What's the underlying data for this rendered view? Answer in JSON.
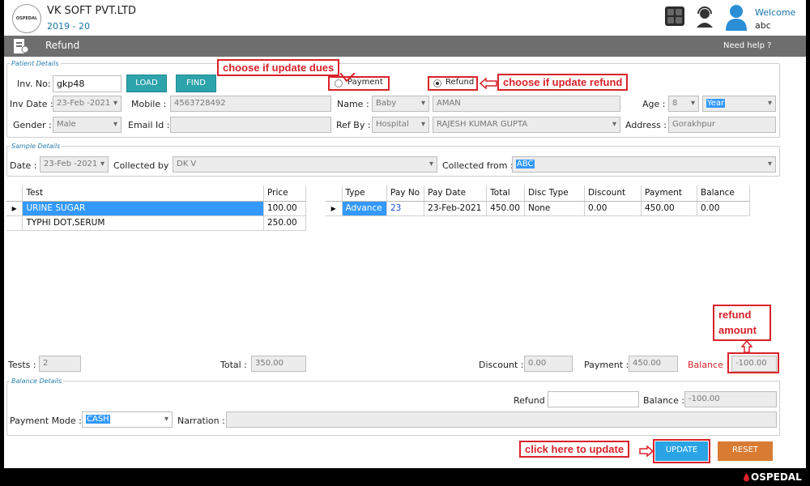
{
  "app": {
    "company": "VK SOFT PVT.LTD",
    "year": "2019 - 20",
    "logo_text": "OSPEDAL",
    "welcome": "Welcome",
    "user": "abc",
    "brand": "OSPEDAL"
  },
  "titlebar": {
    "title": "Refund",
    "help": "Need help ?"
  },
  "patient": {
    "legend": "Patient Details",
    "inv_label": "Inv. No:",
    "inv_value": "gkp48",
    "load_label": "LOAD",
    "find_label": "FIND",
    "payment_radio": "Payment",
    "refund_radio": "Refund",
    "inv_date_label": "Inv Date :",
    "inv_date": "23-Feb -2021",
    "mobile_label": "Mobile :",
    "mobile": "4563728492",
    "name_label": "Name :",
    "name_prefix": "Baby",
    "name": "AMAN",
    "age_label": "Age :",
    "age": "8",
    "age_unit": "Year",
    "gender_label": "Gender :",
    "gender": "Male",
    "email_label": "Email Id :",
    "email": "",
    "refby_label": "Ref By :",
    "refby_type": "Hospital",
    "refby_name": "RAJESH KUMAR GUPTA",
    "address_label": "Address :",
    "address": "Gorakhpur"
  },
  "sample": {
    "legend": "Sample Details",
    "date_label": "Date :",
    "date": "23-Feb -2021",
    "collected_by_label": "Collected by :",
    "collected_by": "DK V",
    "collected_from_label": "Collected from :",
    "collected_from": "ABC"
  },
  "tests_table": {
    "headers": [
      "Test",
      "Price"
    ],
    "rows": [
      [
        "URINE SUGAR",
        "100.00"
      ],
      [
        "TYPHI DOT,SERUM",
        "250.00"
      ]
    ]
  },
  "payments_table": {
    "headers": [
      "Type",
      "Pay No",
      "Pay Date",
      "Total",
      "Disc Type",
      "Discount",
      "Payment",
      "Balance"
    ],
    "rows": [
      [
        "Advance",
        "23",
        "23-Feb-2021",
        "450.00",
        "None",
        "0.00",
        "450.00",
        "0.00"
      ]
    ]
  },
  "summary": {
    "tests_label": "Tests :",
    "tests": "2",
    "total_label": "Total :",
    "total": "350.00",
    "discount_label": "Discount :",
    "discount": "0.00",
    "payment_label": "Payment :",
    "payment": "450.00",
    "balance_label": "Balance :",
    "balance": "-100.00"
  },
  "balance_details": {
    "legend": "Balance Details",
    "refund_label": "Refund",
    "refund": "",
    "balance_label": "Balance :",
    "balance": "-100.00",
    "mode_label": "Payment Mode :",
    "mode": "CASH",
    "narration_label": "Narration :",
    "narration": ""
  },
  "actions": {
    "update": "UPDATE",
    "reset": "RESET"
  },
  "annotations": {
    "dues": "choose if update dues",
    "refund": "choose if update refund",
    "amount_line1": "refund",
    "amount_line2": "amount",
    "update": "click here to update"
  },
  "colors": {
    "accent_teal": "#2da3ab",
    "annotation_red": "#d9222a",
    "update_blue": "#2aa4e4",
    "reset_orange": "#d87b33",
    "selection_blue": "#3399ff"
  }
}
